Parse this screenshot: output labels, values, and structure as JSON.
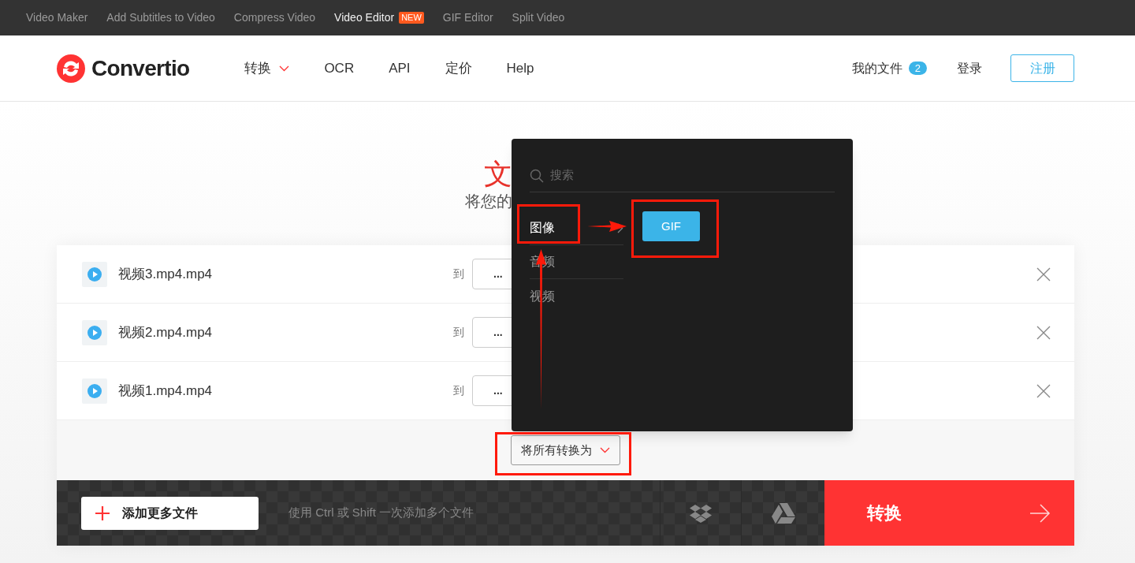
{
  "top_links": [
    {
      "label": "Video Maker",
      "active": false
    },
    {
      "label": "Add Subtitles to Video",
      "active": false
    },
    {
      "label": "Compress Video",
      "active": false
    },
    {
      "label": "Video Editor",
      "active": true,
      "badge": "NEW"
    },
    {
      "label": "GIF Editor",
      "active": false
    },
    {
      "label": "Split Video",
      "active": false
    }
  ],
  "header": {
    "logo": "Convertio",
    "nav": [
      {
        "label": "转换",
        "dropdown": true
      },
      {
        "label": "OCR",
        "dropdown": false
      },
      {
        "label": "API",
        "dropdown": false
      },
      {
        "label": "定价",
        "dropdown": false
      },
      {
        "label": "Help",
        "dropdown": false
      }
    ],
    "my_files": {
      "label": "我的文件",
      "count": "2"
    },
    "login": "登录",
    "register": "注册"
  },
  "hero": {
    "title": "文",
    "subtitle": "将您的"
  },
  "files": [
    {
      "name": "视频3.mp4.mp4",
      "to": "到",
      "format": "..."
    },
    {
      "name": "视频2.mp4.mp4",
      "to": "到",
      "format": "..."
    },
    {
      "name": "视频1.mp4.mp4",
      "to": "到",
      "format": "..."
    }
  ],
  "convert_all": "将所有转换为",
  "bottom_bar": {
    "add_more": "添加更多文件",
    "hint": "使用 Ctrl 或 Shift 一次添加多个文件",
    "convert": "转换"
  },
  "format_menu": {
    "placeholder": "搜索",
    "categories": [
      {
        "label": "图像",
        "selected": true
      },
      {
        "label": "音频",
        "selected": false
      },
      {
        "label": "视频",
        "selected": false
      }
    ],
    "formats": [
      "GIF"
    ]
  }
}
